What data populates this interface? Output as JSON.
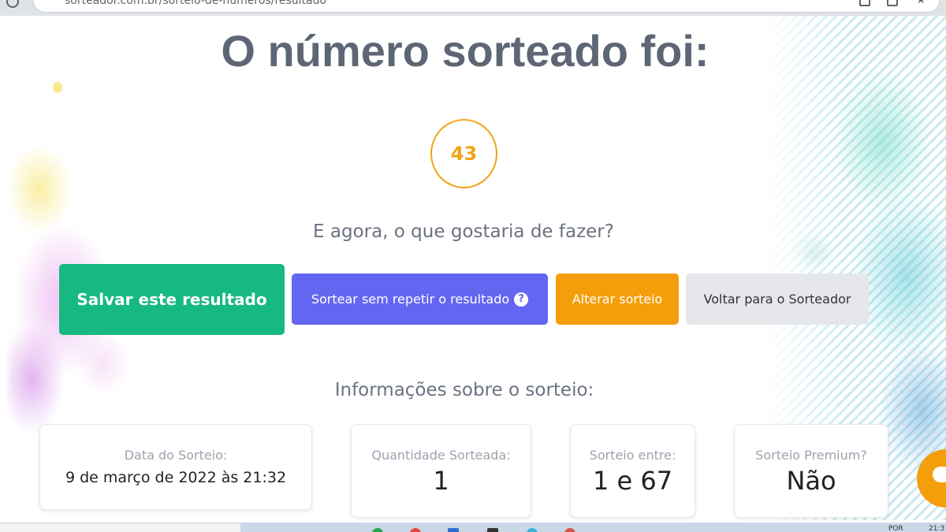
{
  "browser": {
    "url": "sorteador.com.br/sorteio-de-numeros/resultado"
  },
  "page": {
    "headline": "O número sorteado foi:",
    "result_number": "43",
    "question": "E agora, o que gostaria de fazer?",
    "actions": {
      "save": "Salvar este resultado",
      "draw_no_repeat": "Sortear sem repetir o resultado",
      "alter": "Alterar sorteio",
      "back": "Voltar para o Sorteador"
    },
    "help_glyph": "?",
    "info_title": "Informações sobre o sorteio:",
    "info_cards": {
      "date": {
        "label": "Data do Sorteio:",
        "value": "9 de março de 2022 às 21:32"
      },
      "quantity": {
        "label": "Quantidade Sorteada:",
        "value": "1"
      },
      "range": {
        "label": "Sorteio entre:",
        "value": "1 e 67"
      },
      "premium": {
        "label": "Sorteio Premium?",
        "value": "Não"
      }
    }
  },
  "taskbar": {
    "lang": "POR",
    "clock": "21:3"
  },
  "colors": {
    "save": "#16b981",
    "draw_no_repeat": "#6366f1",
    "alter": "#f59e0b",
    "back": "#e5e7eb",
    "result_accent": "#f0a418",
    "headline": "#5e6676"
  },
  "icons": [
    "reload-icon",
    "help-icon",
    "chat-icon",
    "star-icon"
  ]
}
